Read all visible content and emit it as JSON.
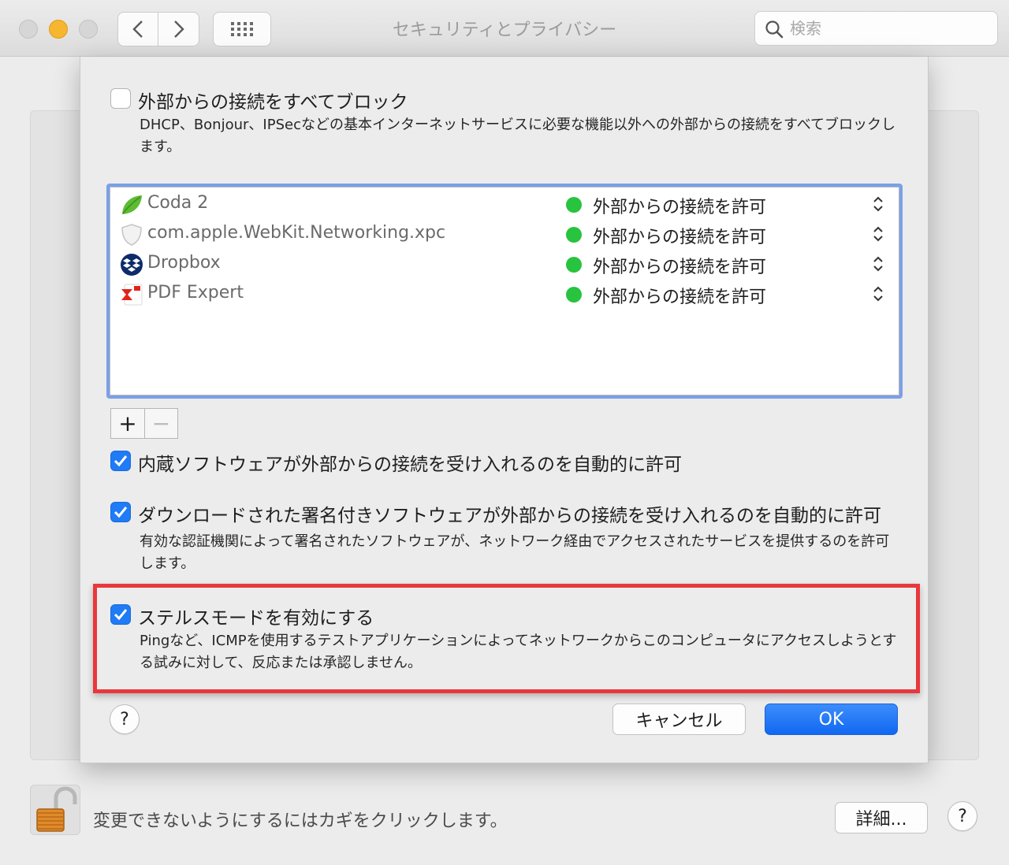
{
  "window": {
    "title": "セキュリティとプライバシー",
    "search_placeholder": "検索"
  },
  "firewall_options": {
    "block_all": {
      "label": "外部からの接続をすべてブロック",
      "checked": false,
      "description": "DHCP、Bonjour、IPSecなどの基本インターネットサービスに必要な機能以外への外部からの接続をすべてブロックします。"
    },
    "apps": [
      {
        "name": "Coda 2",
        "icon": "leaf-icon",
        "status": "外部からの接続を許可",
        "status_color": "#28c33f"
      },
      {
        "name": "com.apple.WebKit.Networking.xpc",
        "icon": "shield-icon",
        "status": "外部からの接続を許可",
        "status_color": "#28c33f"
      },
      {
        "name": "Dropbox",
        "icon": "dropbox-icon",
        "status": "外部からの接続を許可",
        "status_color": "#28c33f"
      },
      {
        "name": "PDF Expert",
        "icon": "pdf-expert-icon",
        "status": "外部からの接続を許可",
        "status_color": "#28c33f"
      }
    ],
    "add_label": "+",
    "remove_label": "−",
    "builtin_auto": {
      "label": "内蔵ソフトウェアが外部からの接続を受け入れるのを自動的に許可",
      "checked": true
    },
    "signed_auto": {
      "label": "ダウンロードされた署名付きソフトウェアが外部からの接続を受け入れるのを自動的に許可",
      "checked": true,
      "description": "有効な認証機関によって署名されたソフトウェアが、ネットワーク経由でアクセスされたサービスを提供するのを許可します。"
    },
    "stealth": {
      "label": "ステルスモードを有効にする",
      "checked": true,
      "description": "Pingなど、ICMPを使用するテストアプリケーションによってネットワークからこのコンピュータにアクセスしようとする試みに対して、反応または承認しません。"
    }
  },
  "sheet_buttons": {
    "help": "?",
    "cancel": "キャンセル",
    "ok": "OK"
  },
  "footer": {
    "lock_text": "変更できないようにするにはカギをクリックします。",
    "detail_button": "詳細...",
    "help": "?"
  },
  "colors": {
    "accent": "#1f7bf6",
    "highlight": "#e8383d",
    "allow_dot": "#28c33f"
  }
}
